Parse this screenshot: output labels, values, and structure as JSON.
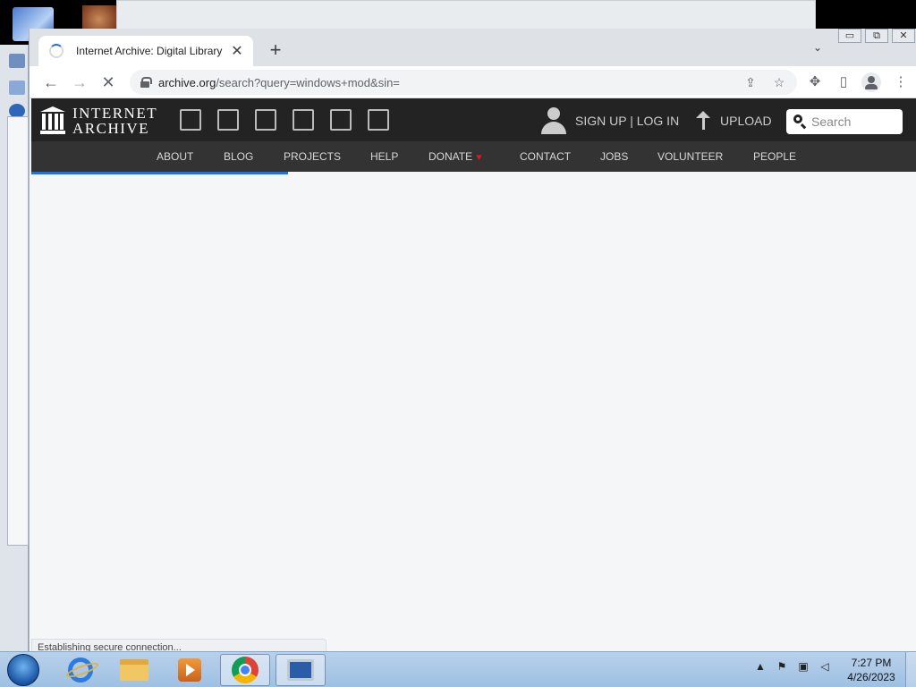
{
  "browser": {
    "tab_title": "Internet Archive: Digital Library of Free & Borrowable Books, Movies, Music & Wayback Machine",
    "tab_close": "✕",
    "new_tab": "+",
    "tab_search": "⌄",
    "url_host": "archive.org",
    "url_path": "/search?query=windows+mod&sin=",
    "window_min": "▭",
    "window_restore": "⧉",
    "window_close": "✕"
  },
  "site": {
    "logo_line1": "INTERNET",
    "logo_line2": "ARCHIVE",
    "signup_login": "SIGN UP | LOG IN",
    "upload": "UPLOAD",
    "search_placeholder": "Search",
    "nav": [
      "ABOUT",
      "BLOG",
      "PROJECTS",
      "HELP",
      "DONATE",
      "CONTACT",
      "JOBS",
      "VOLUNTEER",
      "PEOPLE"
    ],
    "donate_heart": "♥",
    "load_progress": 0.29
  },
  "status_bar": "Establishing secure connection...",
  "taskbar": {
    "clock_time": "7:27 PM",
    "clock_date": "4/26/2023"
  },
  "icons": {
    "back": "arrow-left-icon",
    "forward": "arrow-right-icon",
    "reload": "loading-x-icon",
    "share": "share-icon",
    "bookmark": "star-icon",
    "extensions": "puzzle-icon",
    "sidebar": "side-panel-icon",
    "profile": "profile-icon",
    "menu": "kebab-menu-icon"
  }
}
